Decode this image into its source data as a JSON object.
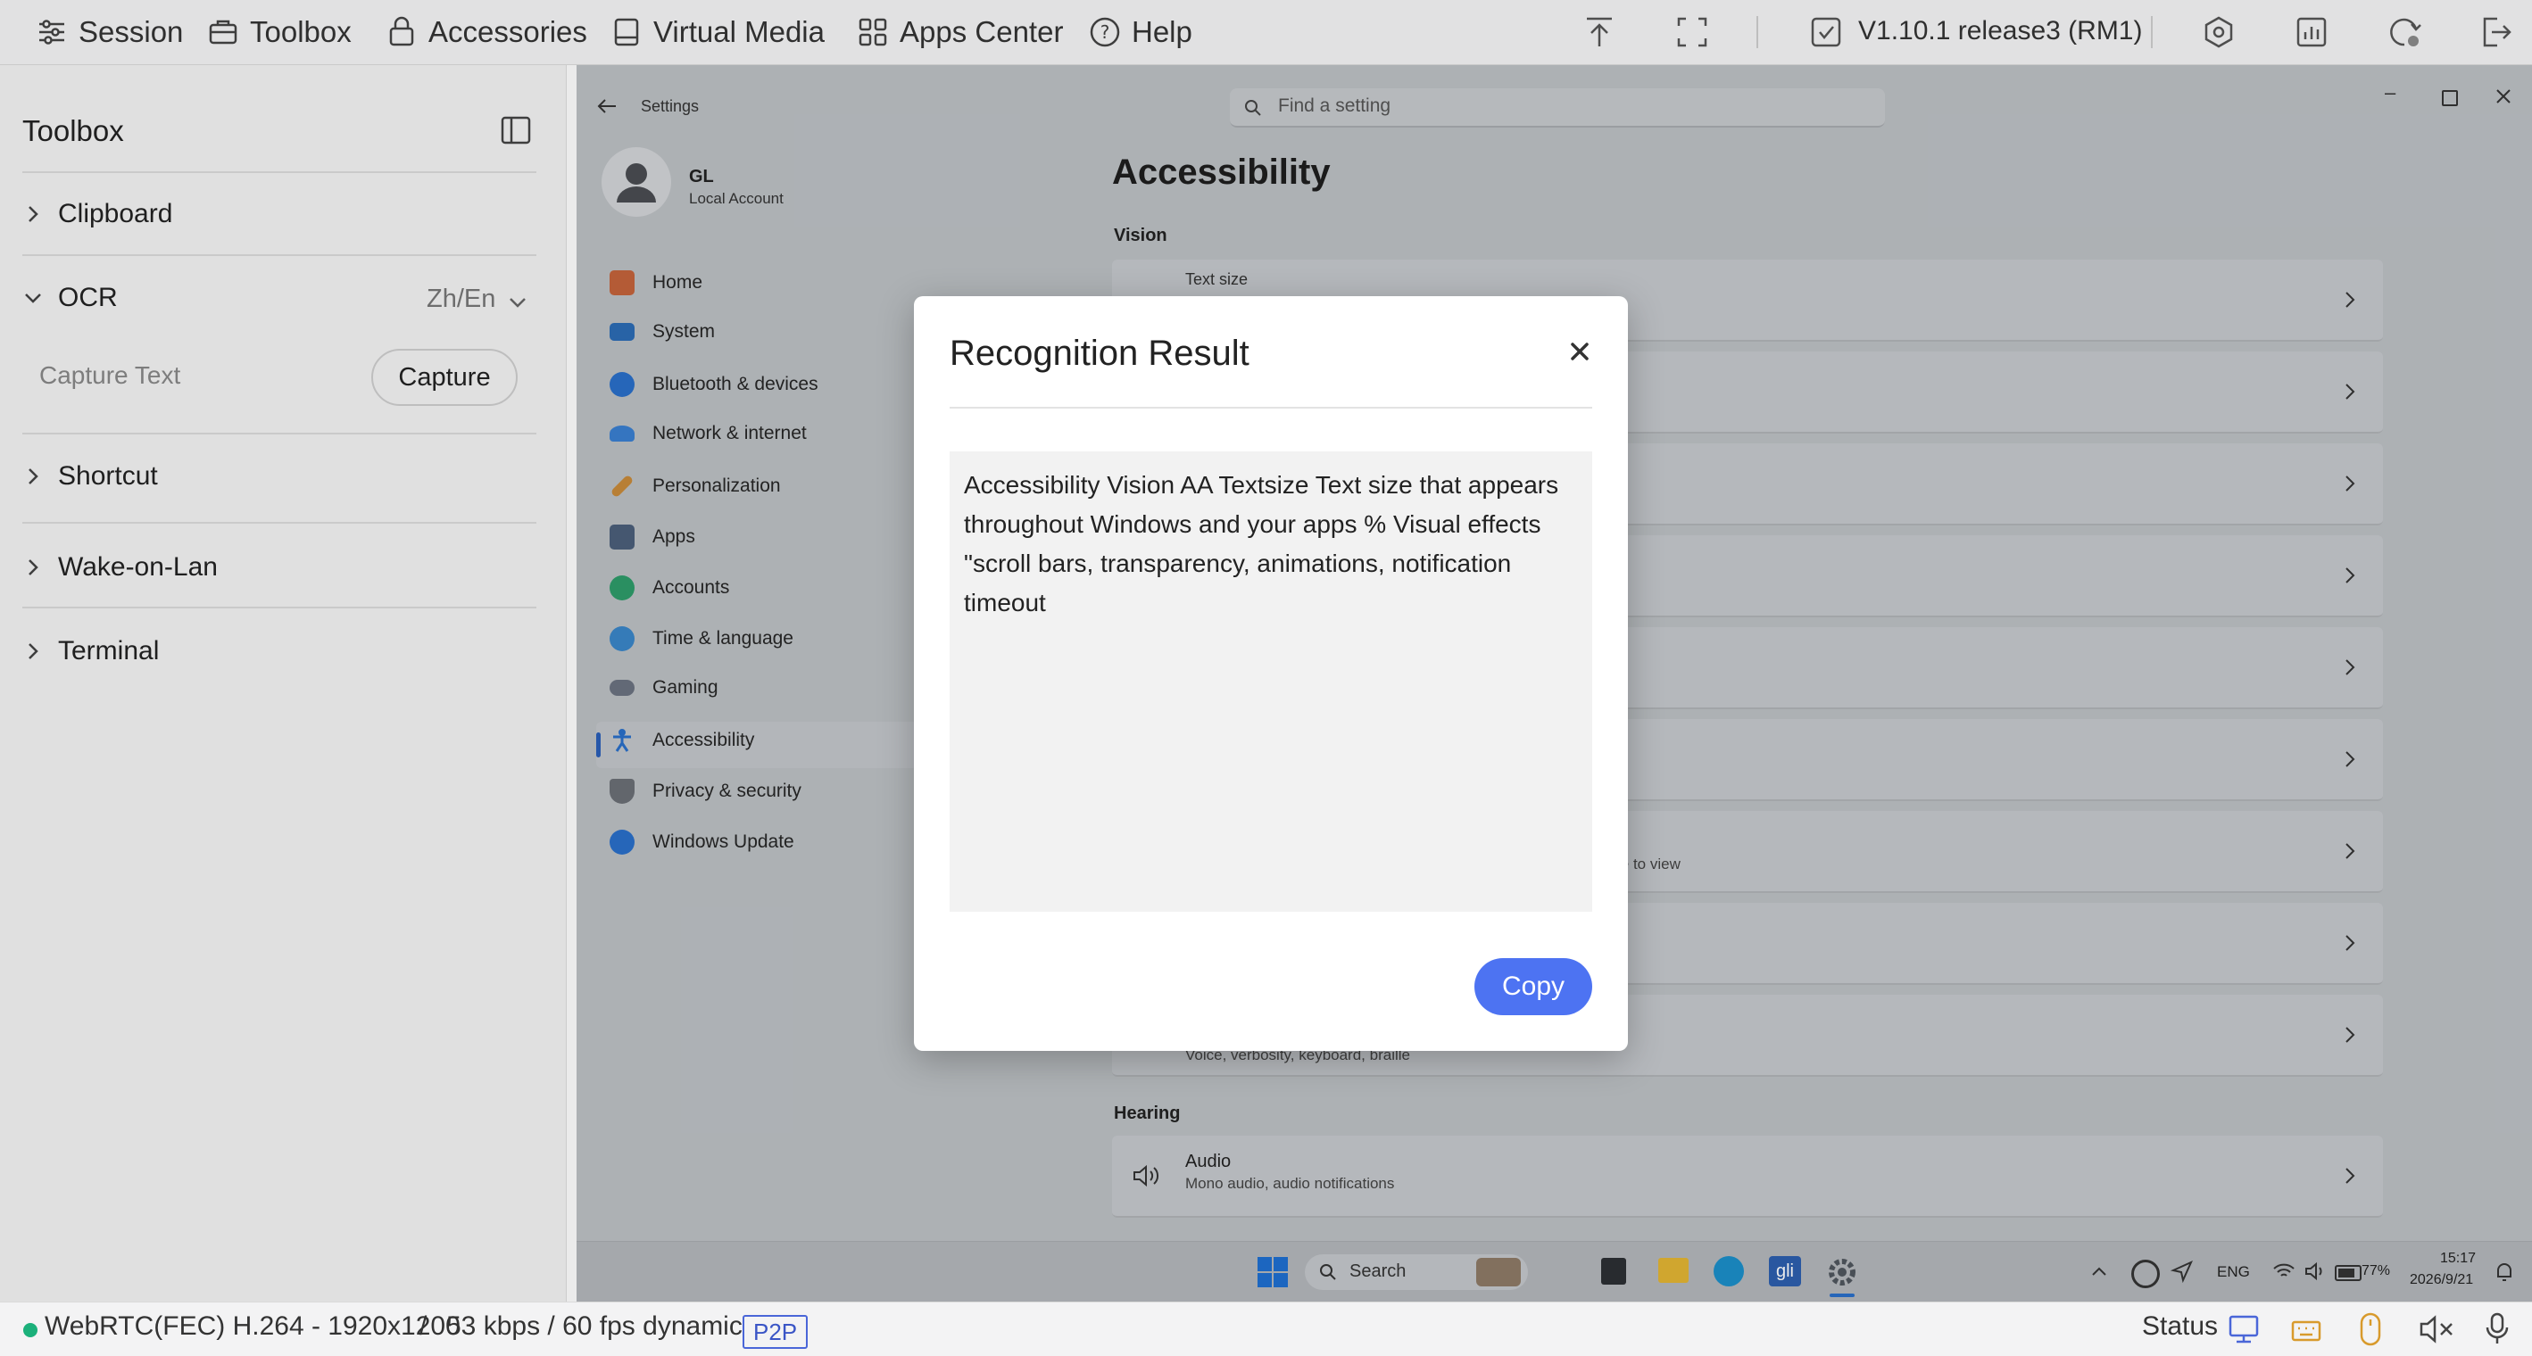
{
  "topbar": {
    "menus": [
      {
        "label": "Session",
        "icon": "session-icon"
      },
      {
        "label": "Toolbox",
        "icon": "toolbox-icon",
        "active": true
      },
      {
        "label": "Accessories",
        "icon": "accessories-icon"
      },
      {
        "label": "Virtual Media",
        "icon": "virtual-media-icon"
      },
      {
        "label": "Apps Center",
        "icon": "apps-center-icon"
      },
      {
        "label": "Help",
        "icon": "help-icon"
      }
    ],
    "version": "V1.10.1 release3 (RM1)"
  },
  "toolbox": {
    "title": "Toolbox",
    "sections": {
      "clipboard": "Clipboard",
      "ocr": "OCR",
      "ocr_language": "Zh/En",
      "capture_text_label": "Capture Text",
      "capture_button": "Capture",
      "shortcut": "Shortcut",
      "wake_on_lan": "Wake-on-Lan",
      "terminal": "Terminal"
    }
  },
  "remote": {
    "settings_label": "Settings",
    "search_placeholder": "Find a setting",
    "user_name": "GL",
    "user_account": "Local Account",
    "nav": [
      {
        "label": "Home",
        "color": "#c4633b"
      },
      {
        "label": "System",
        "color": "#2c6cb5"
      },
      {
        "label": "Bluetooth & devices",
        "color": "#2a6fc9"
      },
      {
        "label": "Network & internet",
        "color": "#3a7fd1"
      },
      {
        "label": "Personalization",
        "color": "#c88a3a"
      },
      {
        "label": "Apps",
        "color": "#4b5f7a"
      },
      {
        "label": "Accounts",
        "color": "#2e9c6a"
      },
      {
        "label": "Time & language",
        "color": "#3a86c8"
      },
      {
        "label": "Gaming",
        "color": "#6b7280"
      },
      {
        "label": "Accessibility",
        "color": "#2a6fc9",
        "selected": true
      },
      {
        "label": "Privacy & security",
        "color": "#6b6f76"
      },
      {
        "label": "Windows Update",
        "color": "#2a6fc9"
      }
    ],
    "page_title": "Accessibility",
    "vision_heading": "Vision",
    "card_text_size": "Text size",
    "card_partial_view": "le to view",
    "card_partial_narrator": "Voice, verbosity, keyboard, braille",
    "hearing_heading": "Hearing",
    "audio_title": "Audio",
    "audio_sub": "Mono audio, audio notifications",
    "taskbar": {
      "search": "Search",
      "lang": "ENG",
      "battery": "77%",
      "time": "15:17",
      "date": "2026/9/21"
    }
  },
  "dialog": {
    "title": "Recognition Result",
    "result_text": "Accessibility Vision AA Textsize Text size that appears throughout Windows and your apps % Visual effects \"scroll bars, transparency, animations, notification timeout",
    "copy_button": "Copy"
  },
  "statusbar": {
    "connection": "WebRTC(FEC) H.264 - 1920x1200",
    "separator": "/",
    "bitrate": "53 kbps / 60 fps dynamic",
    "p2p": "P2P",
    "status_label": "Status",
    "accent_color": "#4a66d8",
    "online_color": "#1bb07a"
  }
}
